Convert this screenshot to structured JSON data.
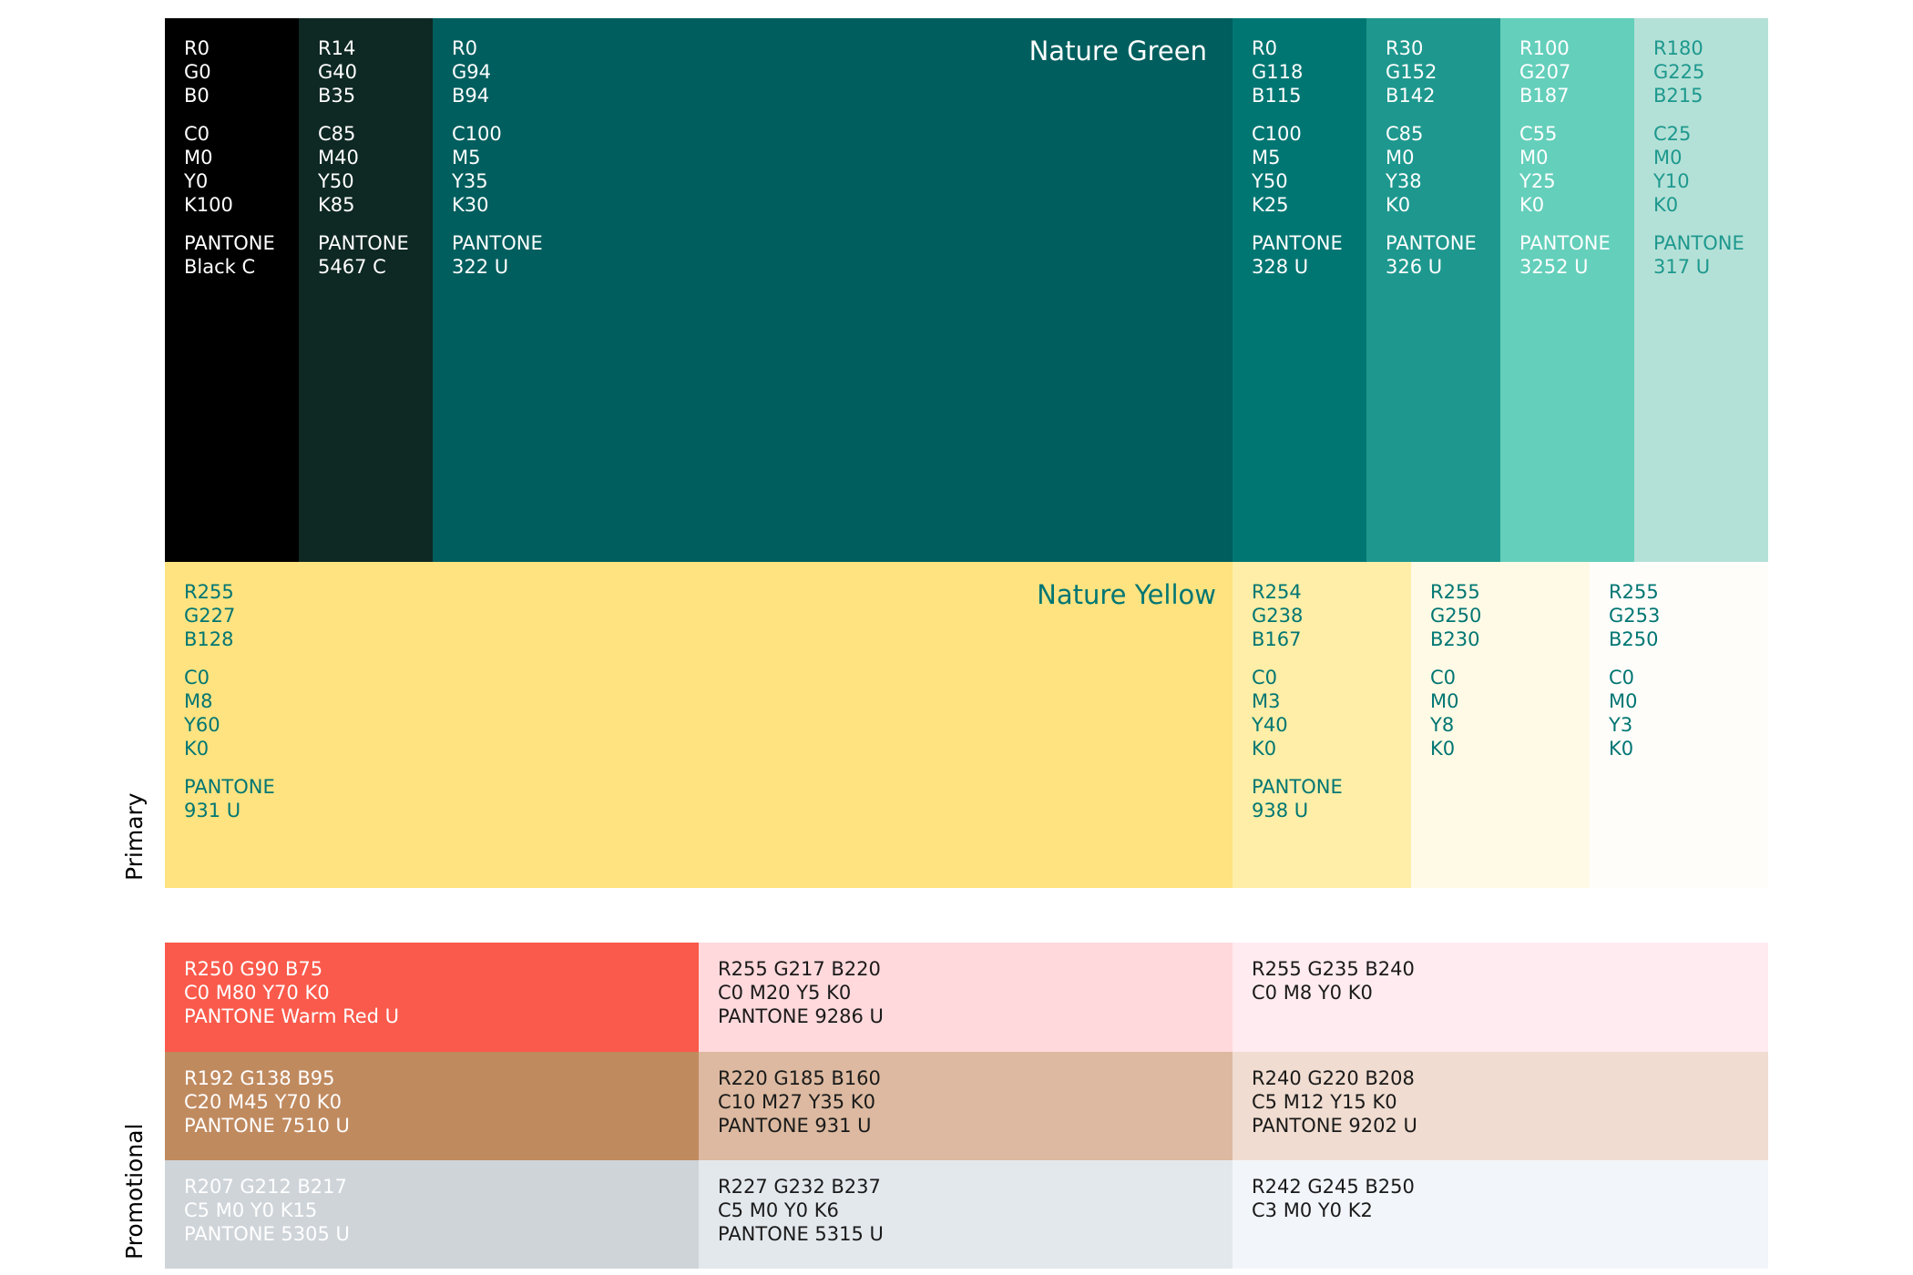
{
  "side_labels": {
    "primary": "Primary",
    "promotional": "Promotional"
  },
  "green_row": [
    {
      "bg": "#000000",
      "fg": "#ffffff",
      "rgb": [
        "R0",
        "G0",
        "B0"
      ],
      "cmyk": [
        "C0",
        "M0",
        "Y0",
        "K100"
      ],
      "pantone": [
        "PANTONE",
        "Black C"
      ]
    },
    {
      "bg": "#0e2823",
      "fg": "#ffffff",
      "rgb": [
        "R14",
        "G40",
        "B35"
      ],
      "cmyk": [
        "C85",
        "M40",
        "Y50",
        "K85"
      ],
      "pantone": [
        "PANTONE",
        "5467 C"
      ]
    },
    {
      "bg": "#005e5e",
      "fg": "#ffffff",
      "title": "Nature Green",
      "rgb": [
        "R0",
        "G94",
        "B94"
      ],
      "cmyk": [
        "C100",
        "M5",
        "Y35",
        "K30"
      ],
      "pantone": [
        "PANTONE",
        "322 U"
      ]
    },
    {
      "bg": "#007673",
      "fg": "#ffffff",
      "rgb": [
        "R0",
        "G118",
        "B115"
      ],
      "cmyk": [
        "C100",
        "M5",
        "Y50",
        "K25"
      ],
      "pantone": [
        "PANTONE",
        "328 U"
      ]
    },
    {
      "bg": "#1e988e",
      "fg": "#ffffff",
      "rgb": [
        "R30",
        "G152",
        "B142"
      ],
      "cmyk": [
        "C85",
        "M0",
        "Y38",
        "K0"
      ],
      "pantone": [
        "PANTONE",
        "326 U"
      ]
    },
    {
      "bg": "#64cfbb",
      "fg": "#ffffff",
      "rgb": [
        "R100",
        "G207",
        "B187"
      ],
      "cmyk": [
        "C55",
        "M0",
        "Y25",
        "K0"
      ],
      "pantone": [
        "PANTONE",
        "3252 U"
      ]
    },
    {
      "bg": "#b4e1d7",
      "fg": "#1e988e",
      "rgb": [
        "R180",
        "G225",
        "B215"
      ],
      "cmyk": [
        "C25",
        "M0",
        "Y10",
        "K0"
      ],
      "pantone": [
        "PANTONE",
        "317 U"
      ]
    }
  ],
  "yellow_row": [
    {
      "bg": "#ffe380",
      "fg": "#007673",
      "title": "Nature Yellow",
      "rgb": [
        "R255",
        "G227",
        "B128"
      ],
      "cmyk": [
        "C0",
        "M8",
        "Y60",
        "K0"
      ],
      "pantone": [
        "PANTONE",
        "931 U"
      ]
    },
    {
      "bg": "#feeea7",
      "fg": "#007673",
      "rgb": [
        "R254",
        "G238",
        "B167"
      ],
      "cmyk": [
        "C0",
        "M3",
        "Y40",
        "K0"
      ],
      "pantone": [
        "PANTONE",
        "938 U"
      ]
    },
    {
      "bg": "#fffae6",
      "fg": "#007673",
      "rgb": [
        "R255",
        "G250",
        "B230"
      ],
      "cmyk": [
        "C0",
        "M0",
        "Y8",
        "K0"
      ],
      "pantone": []
    },
    {
      "bg": "#fffdfa",
      "fg": "#007673",
      "rgb": [
        "R255",
        "G253",
        "B250"
      ],
      "cmyk": [
        "C0",
        "M0",
        "Y3",
        "K0"
      ],
      "pantone": []
    }
  ],
  "promo": [
    {
      "bg": "#fa5a4b",
      "fg": "#ffffff",
      "lines": [
        "R250  G90  B75",
        "C0  M80  Y70  K0",
        "PANTONE Warm Red U"
      ]
    },
    {
      "bg": "#ffd9dc",
      "fg": "#1a1a1a",
      "lines": [
        "R255  G217  B220",
        "C0  M20  Y5  K0",
        "PANTONE 9286 U"
      ]
    },
    {
      "bg": "#ffebf0",
      "fg": "#1a1a1a",
      "lines": [
        "R255  G235  B240",
        "C0  M8  Y0  K0"
      ]
    },
    {
      "bg": "#c08a5f",
      "fg": "#ffffff",
      "lines": [
        "R192  G138  B95",
        "C20  M45  Y70  K0",
        "PANTONE 7510 U"
      ]
    },
    {
      "bg": "#dcb9a0",
      "fg": "#1a1a1a",
      "lines": [
        "R220  G185  B160",
        "C10  M27  Y35  K0",
        "PANTONE 931 U"
      ]
    },
    {
      "bg": "#f0dcd0",
      "fg": "#1a1a1a",
      "lines": [
        "R240  G220  B208",
        "C5  M12  Y15  K0",
        "PANTONE 9202 U"
      ]
    },
    {
      "bg": "#cfd4d9",
      "fg": "#ffffff",
      "lines": [
        "R207  G212  B217",
        "C5  M0  Y0  K15",
        "PANTONE 5305 U"
      ]
    },
    {
      "bg": "#e3e8ed",
      "fg": "#1a1a1a",
      "lines": [
        "R227  G232  B237",
        "C5  M0  Y0  K6",
        "PANTONE 5315 U"
      ]
    },
    {
      "bg": "#f2f5fa",
      "fg": "#1a1a1a",
      "lines": [
        "R242  G245  B250",
        "C3  M0  Y0  K2"
      ]
    }
  ]
}
